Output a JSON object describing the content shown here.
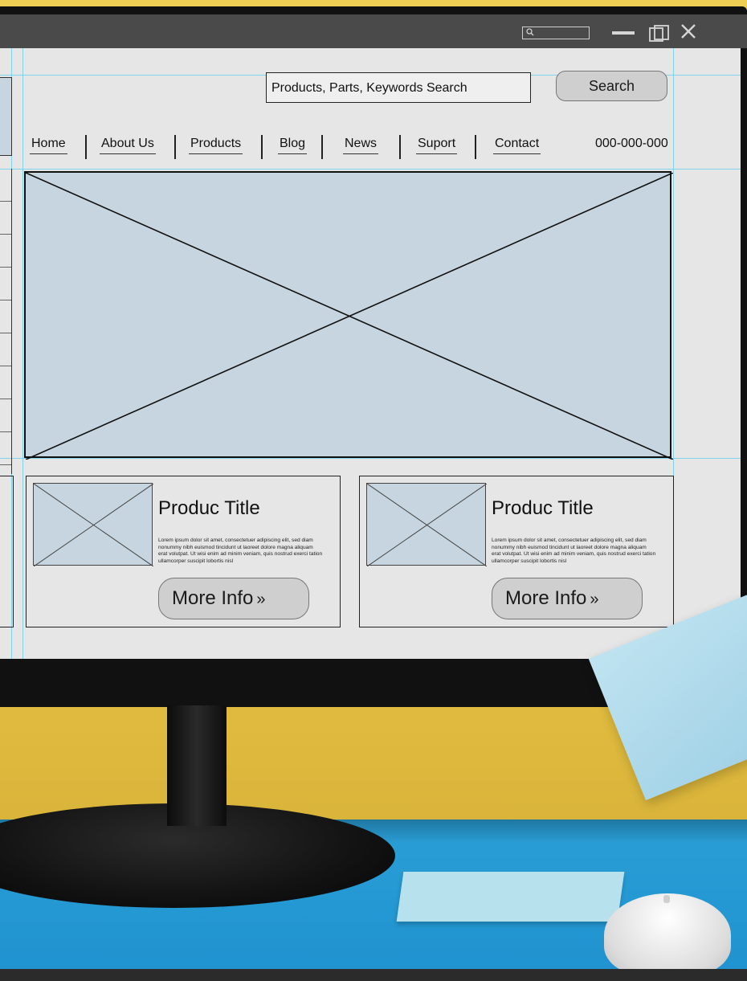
{
  "window": {
    "search_icon": "search-icon",
    "minimize_icon": "minimize-icon",
    "maximize_icon": "restore-icon",
    "close_icon": "close-icon"
  },
  "header": {
    "search_placeholder": "Products, Parts, Keywords Search",
    "search_button": "Search",
    "phone": "000-000-000"
  },
  "nav": {
    "items": [
      "Home",
      "About Us",
      "Products",
      "Blog",
      "News",
      "Suport",
      "Contact"
    ]
  },
  "cards": [
    {
      "title": "Produc Title",
      "body": "Lorem ipsum dolor sit amet, consectetuer adipiscing elit, sed diam nonummy nibh euismod tincidunt ut laoreet dolore magna aliquam erat volutpat. Ut wisi enim ad minim veniam, quis nostrud exerci tation ullamcorper suscipit lobortis nisl",
      "button": "More Info",
      "button_icon": "double-chevron-right-icon"
    },
    {
      "title": "Produc Title",
      "body": "Lorem ipsum dolor sit amet, consectetuer adipiscing elit, sed diam nonummy nibh euismod tincidunt ut laoreet dolore magna aliquam erat volutpat. Ut wisi enim ad minim veniam, quis nostrud exerci tation ullamcorper suscipit lobortis nisl",
      "button": "More Info",
      "button_icon": "double-chevron-right-icon"
    }
  ],
  "chevron_glyph": "»",
  "colors": {
    "placeholder_fill": "#c6d5df",
    "guides": "#7fd3ea",
    "wall": "#e9c64a",
    "desk": "#2a9fd6"
  }
}
